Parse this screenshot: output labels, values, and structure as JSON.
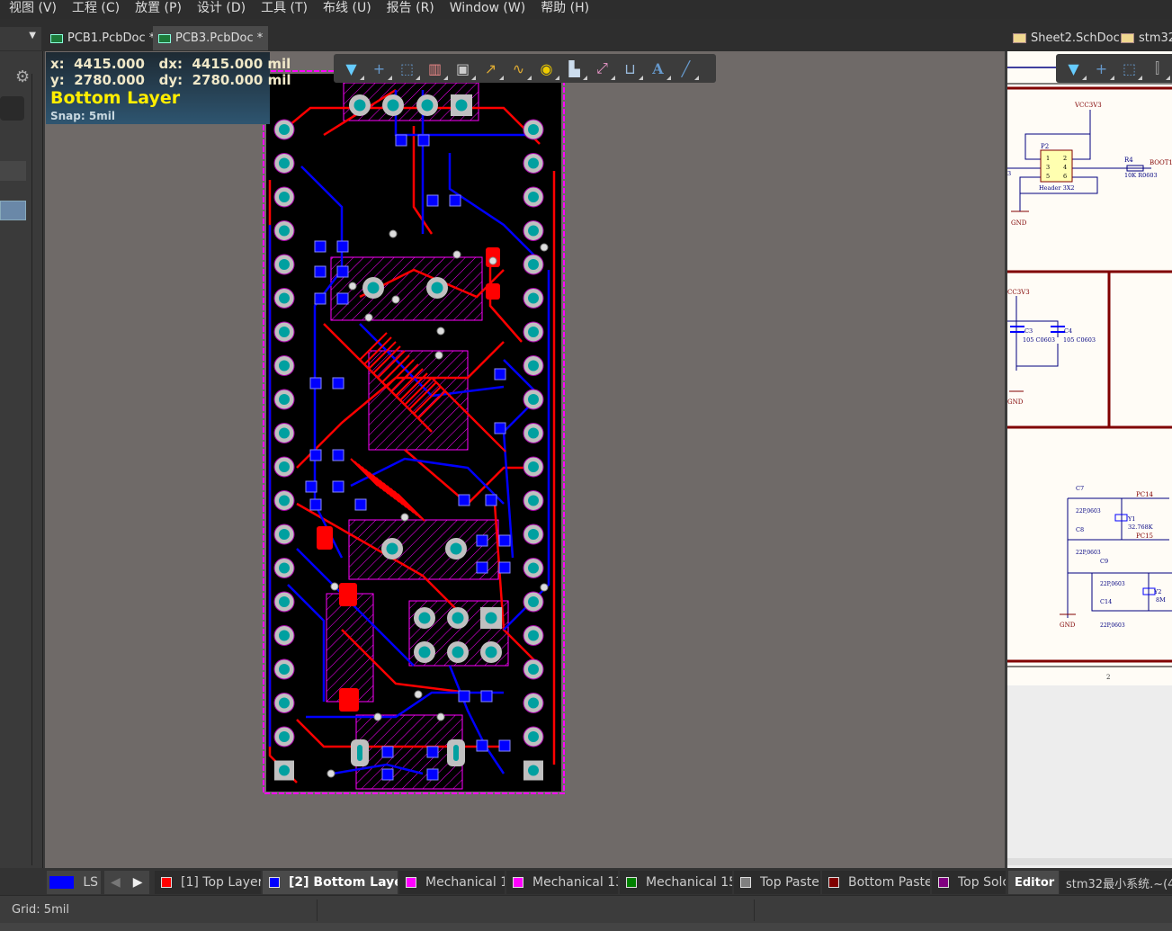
{
  "menu": [
    "视图 (V)",
    "工程 (C)",
    "放置 (P)",
    "设计 (D)",
    "工具 (T)",
    "布线 (U)",
    "报告 (R)",
    "Window (W)",
    "帮助 (H)"
  ],
  "tabs": {
    "left": [
      {
        "label": "PCB1.PcbDoc *"
      },
      {
        "label": "PCB3.PcbDoc *",
        "active": true
      }
    ],
    "right": [
      {
        "label": "Sheet2.SchDoc"
      },
      {
        "label": "stm32"
      }
    ]
  },
  "hud": {
    "x_line": "x:  4415.000   dx:  4415.000 mil",
    "y_line": "y:  2780.000   dy:  2780.000 mil",
    "layer": "Bottom Layer",
    "snap": "Snap: 5mil"
  },
  "pcb_toolbar": [
    "filter-icon",
    "cross-probe-icon",
    "select-rect-icon",
    "align-icon",
    "component-icon",
    "route-icon",
    "diff-pair-icon",
    "via-icon",
    "polygon-icon",
    "interactive-route-icon",
    "dimension-icon",
    "text-icon",
    "line-icon"
  ],
  "pcb_toolbar_text": "A",
  "schematic": {
    "labels": {
      "vcc": "VCC3V3",
      "p2": "P2",
      "header": "Header 3X2",
      "pins": [
        "1",
        "2",
        "3",
        "4",
        "5",
        "6"
      ],
      "r4": "R4",
      "r4val": "10K R0603",
      "boot": "BOOT1",
      "gnd": "GND",
      "left_net": "3",
      "vcc2": "CC3V3",
      "c3": "C3",
      "c3val": "105 C0603",
      "c4": "C4",
      "c4val": "105 C0603",
      "c7": "C7",
      "c8": "C8",
      "c9": "C9",
      "c14": "C14",
      "cval": "22P,0603",
      "pc14": "PC14",
      "pc15": "PC15",
      "y1": "Y1",
      "y1val": "32.768K",
      "y2": "Y2",
      "y2val": "8M",
      "sheet_no": "2"
    }
  },
  "layers": [
    {
      "label": "[1] Top Layer",
      "color": "#ff0000"
    },
    {
      "label": "[2] Bottom Layer",
      "color": "#0000ff",
      "active": true
    },
    {
      "label": "Mechanical 1",
      "color": "#ff00ff"
    },
    {
      "label": "Mechanical 13",
      "color": "#ff00ff"
    },
    {
      "label": "Mechanical 15",
      "color": "#008000"
    },
    {
      "label": "Top Paste",
      "color": "#808080"
    },
    {
      "label": "Bottom Paste",
      "color": "#800000"
    },
    {
      "label": "Top Solc",
      "color": "#800080"
    }
  ],
  "layer_set": {
    "label": "LS",
    "color": "#0000ff"
  },
  "panel_tabs": {
    "editor": "Editor",
    "project": "stm32最小系统.~(4"
  },
  "status": {
    "grid": "Grid: 5mil"
  },
  "colors": {
    "top_layer": "#ff0000",
    "bottom_layer": "#0000ff",
    "pad": "#c0c0c0",
    "pad_hole": "#00a0a0",
    "board": "#000000",
    "outline": "#ff00ff",
    "sch_wire": "#000080",
    "sch_label": "#800000"
  }
}
